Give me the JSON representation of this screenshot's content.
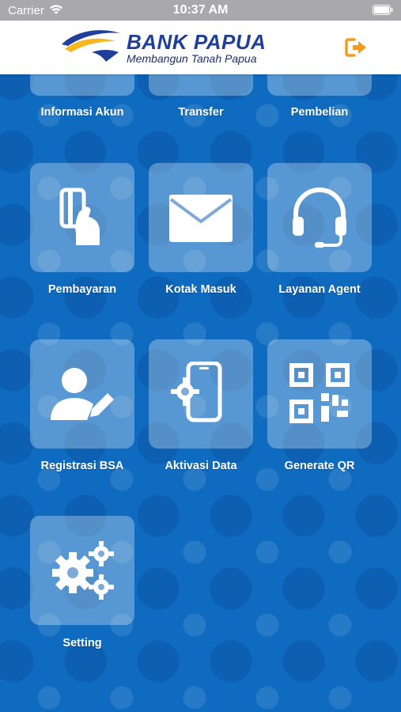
{
  "status_bar": {
    "carrier": "Carrier",
    "time": "10:37 AM"
  },
  "header": {
    "bank_name": "BANK PAPUA",
    "tagline": "Membangun Tanah Papua",
    "colors": {
      "brand_blue": "#1f3f9a",
      "accent_orange": "#f39c1e"
    }
  },
  "menu": {
    "row0": [
      {
        "label": "Informasi Akun"
      },
      {
        "label": "Transfer"
      },
      {
        "label": "Pembelian"
      }
    ],
    "row1": [
      {
        "label": "Pembayaran",
        "icon": "card-hand-icon"
      },
      {
        "label": "Kotak Masuk",
        "icon": "envelope-icon"
      },
      {
        "label": "Layanan Agent",
        "icon": "headset-icon"
      }
    ],
    "row2": [
      {
        "label": "Registrasi BSA",
        "icon": "user-edit-icon"
      },
      {
        "label": "Aktivasi Data",
        "icon": "phone-gear-icon"
      },
      {
        "label": "Generate QR",
        "icon": "qr-code-icon"
      }
    ],
    "row3": [
      {
        "label": "Setting",
        "icon": "gears-icon"
      }
    ]
  },
  "colors": {
    "background": "#0f6bc0",
    "tile": "rgba(255,255,255,0.30)",
    "text": "#ffffff"
  }
}
